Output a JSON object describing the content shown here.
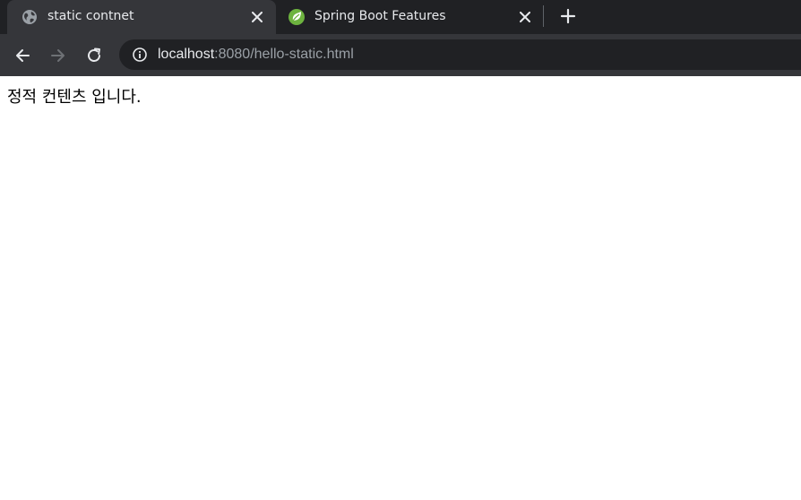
{
  "tabs": [
    {
      "title": "static contnet",
      "icon": "globe-icon",
      "active": true
    },
    {
      "title": "Spring Boot Features",
      "icon": "spring-leaf-icon",
      "active": false
    }
  ],
  "address_bar": {
    "host": "localhost",
    "rest": ":8080/hello-static.html"
  },
  "page": {
    "text": "정적 컨텐츠 입니다."
  },
  "colors": {
    "tabstrip_bg": "#202124",
    "active_tab_bg": "#35363a",
    "omnibox_bg": "#202124",
    "spring_green": "#6db33f"
  }
}
